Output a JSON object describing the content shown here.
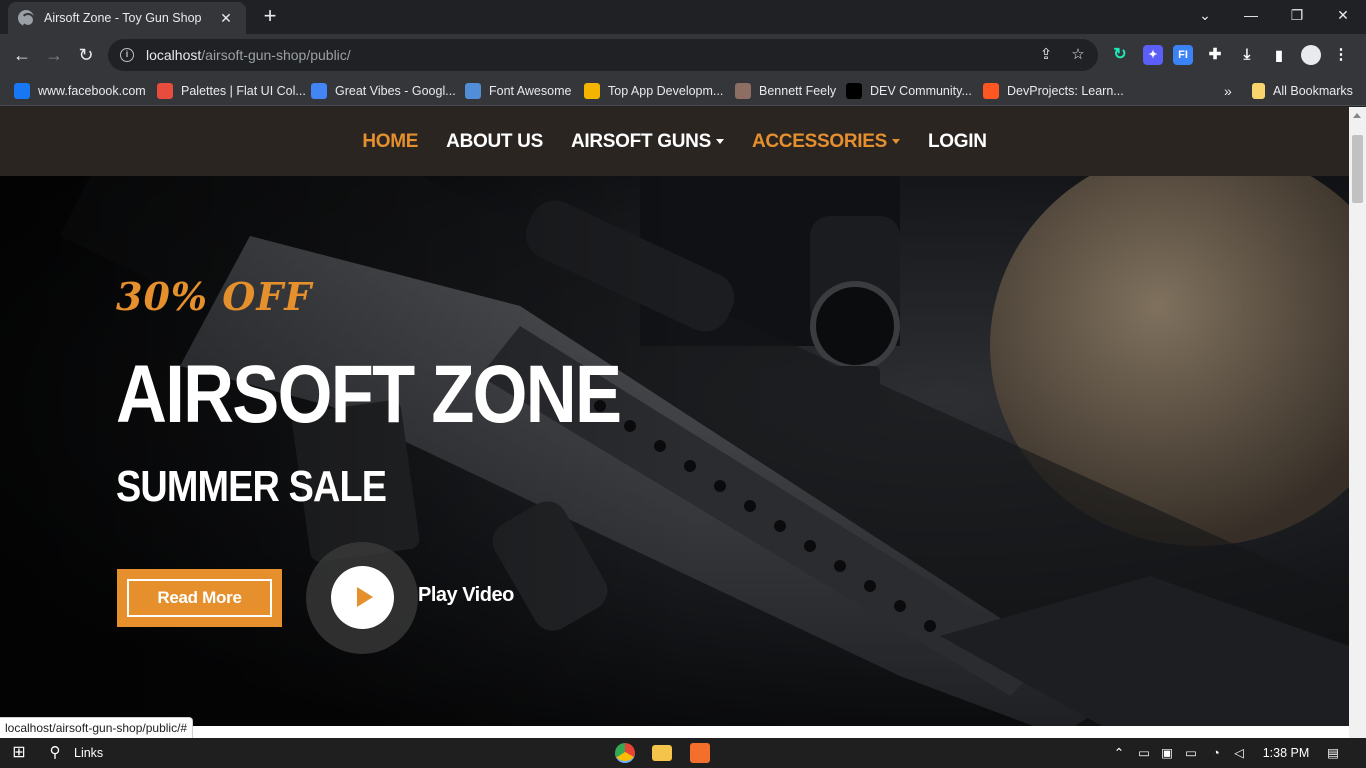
{
  "browser": {
    "tab_title": "Airsoft Zone - Toy Gun Shop",
    "url_host": "localhost",
    "url_path": "/airsoft-gun-shop/public/",
    "bookmarks": [
      {
        "label": "www.facebook.com",
        "icon": "facebook-icon",
        "color": "#1877f2"
      },
      {
        "label": "Palettes | Flat UI Col...",
        "icon": "palette-icon",
        "color": "#e74c3c"
      },
      {
        "label": "Great Vibes - Googl...",
        "icon": "google-fonts-icon",
        "color": "#4285f4"
      },
      {
        "label": "Font Awesome",
        "icon": "flag-icon",
        "color": "#528dd7"
      },
      {
        "label": "Top App Developm...",
        "icon": "grid-icon",
        "color": "#f4b400"
      },
      {
        "label": "Bennett Feely",
        "icon": "avatar-icon",
        "color": "#8d6e63"
      },
      {
        "label": "DEV Community...",
        "icon": "dev-icon",
        "color": "#000000"
      },
      {
        "label": "DevProjects: Learn...",
        "icon": "devprojects-icon",
        "color": "#ff5722"
      }
    ],
    "all_bookmarks": "All Bookmarks",
    "status_url": "localhost/airsoft-gun-shop/public/#"
  },
  "site": {
    "accent": "#e58f2d",
    "nav": [
      {
        "label": "HOME",
        "active": true,
        "dropdown": false
      },
      {
        "label": "ABOUT US",
        "active": false,
        "dropdown": false
      },
      {
        "label": "AIRSOFT GUNS",
        "active": false,
        "dropdown": true
      },
      {
        "label": "ACCESSORIES",
        "active": true,
        "dropdown": true
      },
      {
        "label": "LOGIN",
        "active": false,
        "dropdown": false
      }
    ],
    "hero": {
      "discount": "30% OFF",
      "title": "AIRSOFT ZONE",
      "subtitle": "SUMMER SALE",
      "read_more": "Read More",
      "play_video": "Play Video"
    }
  },
  "taskbar": {
    "search_label": "Links",
    "time": "1:38 PM"
  }
}
